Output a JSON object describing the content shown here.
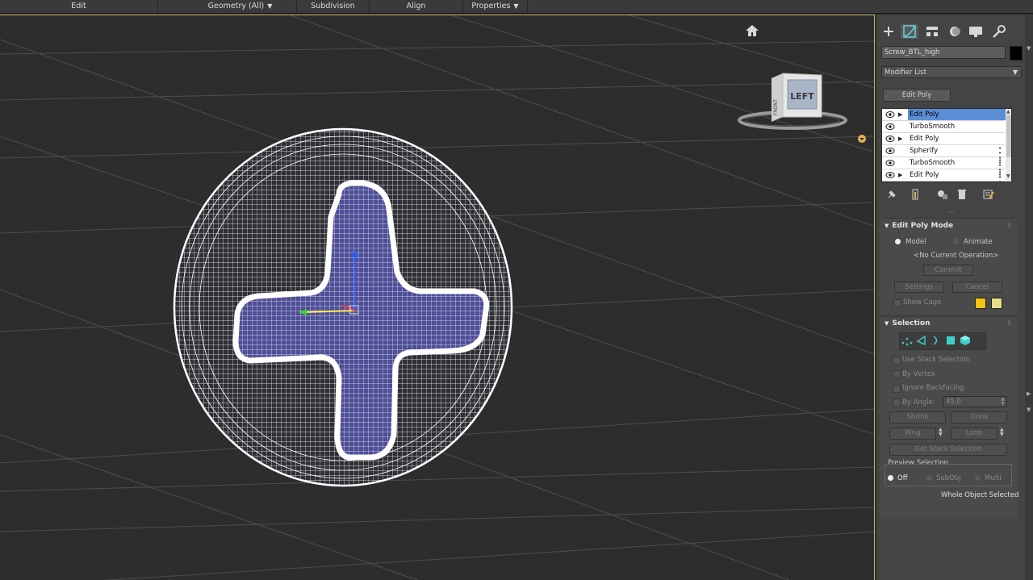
{
  "ribbon": {
    "items": [
      {
        "label": "Edit",
        "caret": false
      },
      {
        "label": "Geometry (All)",
        "caret": true
      },
      {
        "label": "Subdivision",
        "caret": false
      },
      {
        "label": "Align",
        "caret": false
      },
      {
        "label": "Properties",
        "caret": true
      }
    ]
  },
  "viewport": {
    "viewcube_label": "LEFT",
    "viewcube_side_label": "FRONT",
    "icons": [
      "home-icon",
      "viewcube-menu-icon"
    ]
  },
  "command_panel": {
    "tabs": [
      "create-icon",
      "modify-icon",
      "hierarchy-icon",
      "motion-icon",
      "display-icon",
      "utilities-icon"
    ],
    "object_name": "Screw_BTL_high",
    "object_color": "#000000",
    "modifier_list_label": "Modifier List",
    "quick_button": "Edit Poly",
    "stack": [
      {
        "label": "Edit Poly",
        "expandable": true,
        "selected": true,
        "has_dots": false
      },
      {
        "label": "TurboSmooth",
        "expandable": false,
        "selected": false,
        "has_dots": false
      },
      {
        "label": "Edit Poly",
        "expandable": true,
        "selected": false,
        "has_dots": false
      },
      {
        "label": "Spherify",
        "expandable": false,
        "selected": false,
        "has_dots": true
      },
      {
        "label": "TurboSmooth",
        "expandable": false,
        "selected": false,
        "has_dots": true
      },
      {
        "label": "Edit Poly",
        "expandable": true,
        "selected": false,
        "has_dots": true
      }
    ],
    "stack_tools": [
      "pin-stack-icon",
      "show-end-result-icon",
      "make-unique-icon",
      "remove-modifier-icon",
      "configure-sets-icon"
    ],
    "edit_poly_mode": {
      "title": "Edit Poly Mode",
      "model_label": "Model",
      "animate_label": "Animate",
      "current_operation": "<No Current Operation>",
      "commit_label": "Commit",
      "settings_label": "Settings",
      "cancel_label": "Cancel",
      "show_cage_label": "Show Cage",
      "cage_colors": [
        "#f2c40f",
        "#e6df8a"
      ]
    },
    "selection": {
      "title": "Selection",
      "use_stack_selection": "Use Stack Selection",
      "by_vertex": "By Vertex",
      "ignore_backfacing": "Ignore Backfacing",
      "by_angle": "By Angle:",
      "angle_value": "45,0",
      "shrink": "Shrink",
      "grow": "Grow",
      "ring": "Ring",
      "loop": "Loop",
      "get_stack_selection": "Get Stack Selection",
      "preview_selection": "Preview Selection",
      "preview_off": "Off",
      "preview_subobj": "SubObj",
      "preview_multi": "Multi",
      "status": "Whole Object Selected",
      "accent_color": "#3ed0c8"
    }
  }
}
